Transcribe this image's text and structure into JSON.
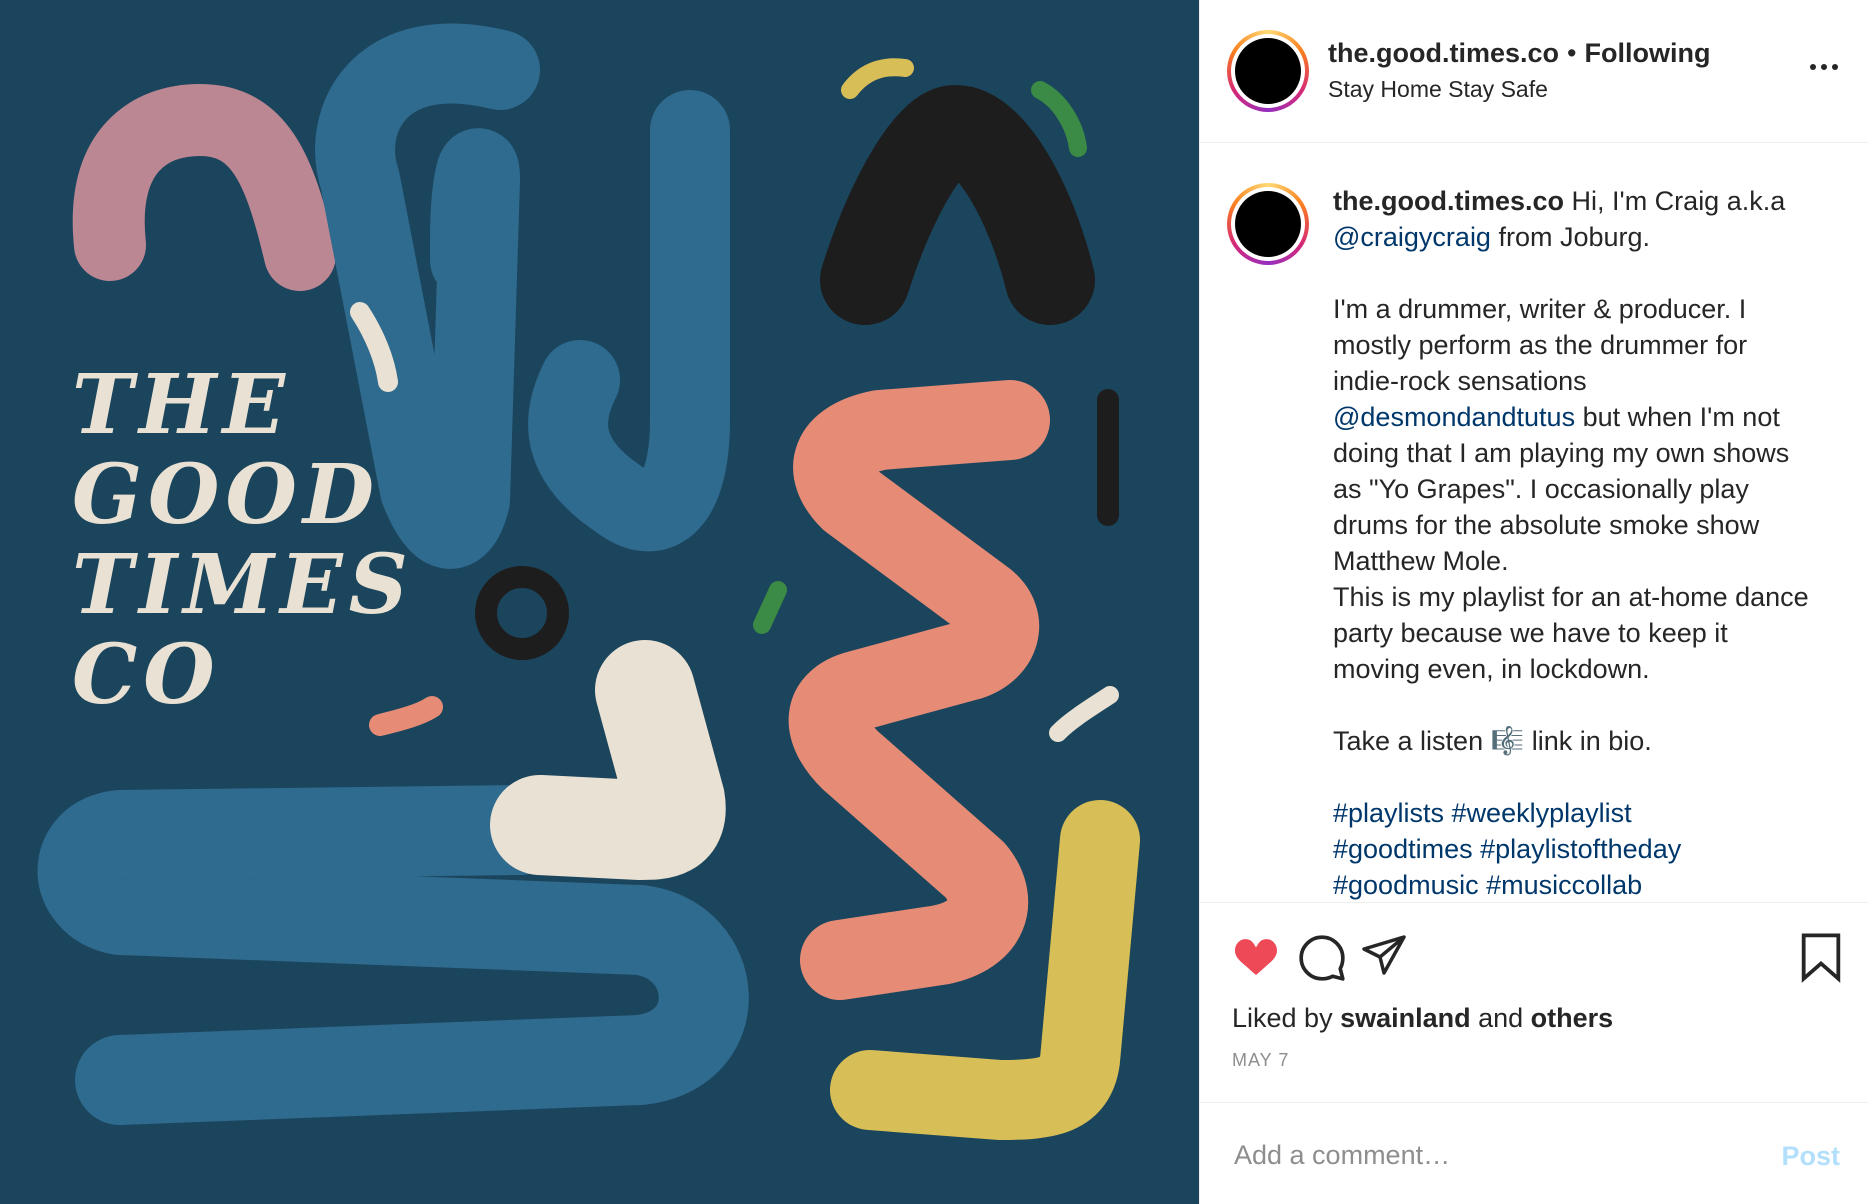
{
  "header": {
    "username": "the.good.times.co",
    "separator": "•",
    "follow_status": "Following",
    "location": "Stay Home Stay Safe",
    "more_icon": "more-horizontal-icon"
  },
  "media": {
    "logo_lines": [
      "THE",
      "GOOD",
      "TIMES",
      "CO"
    ],
    "background_color": "#1b455c"
  },
  "caption": {
    "username": "the.good.times.co",
    "intro_text": " Hi, I'm Craig a.k.a ",
    "mention1": "@craigycraig",
    "after_mention1": " from Joburg.",
    "para1_a": "I'm a drummer, writer & producer. I mostly perform as the drummer for indie-rock sensations ",
    "mention2": "@desmondandtutus",
    "para1_b": " but when I'm not doing that I am playing my own shows as \"Yo Grapes\". I occasionally play drums for the absolute smoke show Matthew Mole.",
    "para2": "This is my playlist for an at-home dance party because we have to keep it moving even, in lockdown.",
    "para3_a": "Take a listen ",
    "music_emoji": "🎼",
    "para3_b": " link in bio.",
    "hashtags_line1": "#playlists #weeklyplaylist",
    "hashtags_line2": "#goodtimes #playlistoftheday",
    "hashtags_line3": "#goodmusic #musiccollab"
  },
  "actions": {
    "like_icon": "heart-filled-icon",
    "comment_icon": "comment-icon",
    "share_icon": "paper-plane-icon",
    "save_icon": "bookmark-icon",
    "liked_by_prefix": "Liked by ",
    "liked_by_user": "swainland",
    "liked_by_and": " and ",
    "liked_by_others": "others",
    "date": "MAY 7",
    "like_color": "#ed4956"
  },
  "comment_box": {
    "placeholder": "Add a comment…",
    "post_label": "Post",
    "post_color": "#b2dffc"
  }
}
